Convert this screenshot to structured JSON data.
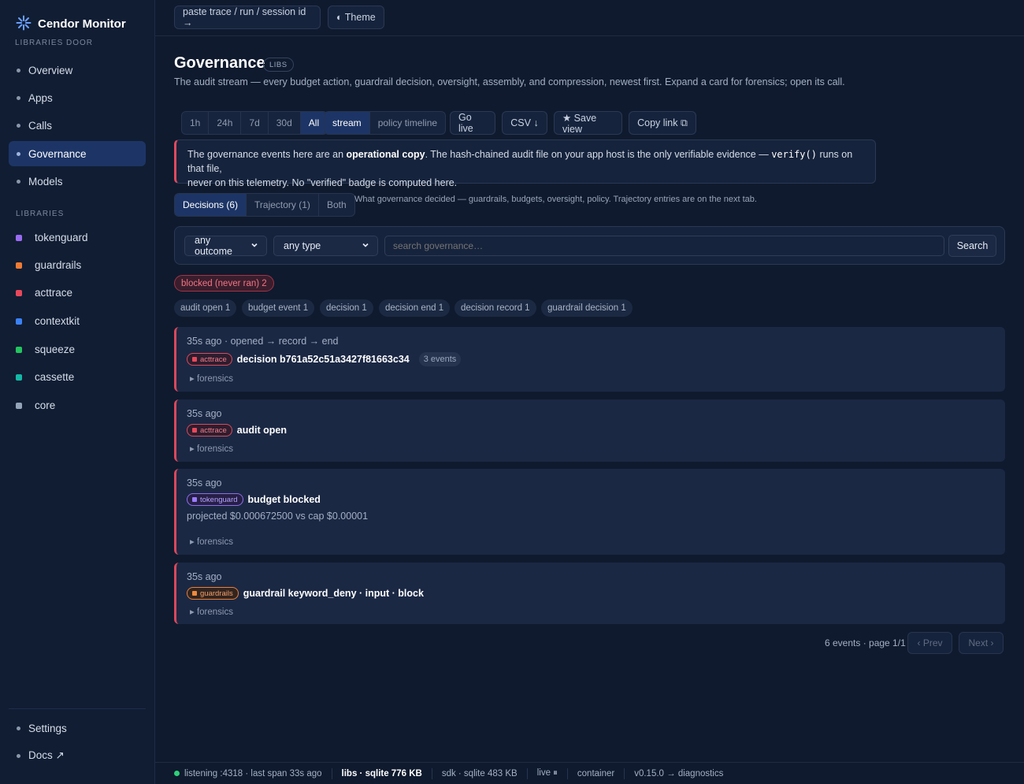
{
  "app": {
    "name": "Cendor Monitor",
    "subtitle": "LIBRARIES DOOR"
  },
  "sidebar": {
    "nav": [
      {
        "label": "Overview"
      },
      {
        "label": "Apps"
      },
      {
        "label": "Calls"
      },
      {
        "label": "Governance",
        "active": true
      },
      {
        "label": "Models"
      }
    ],
    "libraries_label": "LIBRARIES",
    "libraries": [
      {
        "label": "tokenguard",
        "color": "#9a6bf2"
      },
      {
        "label": "guardrails",
        "color": "#f07b32"
      },
      {
        "label": "acttrace",
        "color": "#e8485b"
      },
      {
        "label": "contextkit",
        "color": "#3b82f6"
      },
      {
        "label": "squeeze",
        "color": "#22c55e"
      },
      {
        "label": "cassette",
        "color": "#14b8a6"
      },
      {
        "label": "core",
        "color": "#94a3b8"
      }
    ],
    "footer": [
      {
        "label": "Settings"
      },
      {
        "label": "Docs ↗"
      }
    ]
  },
  "topbar": {
    "trace_input": "paste trace / run / session id →",
    "theme": "◐ Theme"
  },
  "page": {
    "title": "Governance",
    "badge": "LIBS",
    "subtitle": "The audit stream — every budget action, guardrail decision, oversight, assembly, and compression, newest first. Expand a card for forensics; open its call."
  },
  "toolbar": {
    "ranges": [
      "1h",
      "24h",
      "7d",
      "30d",
      "All"
    ],
    "active_range": "All",
    "views": [
      "stream",
      "policy timeline"
    ],
    "active_view": "stream",
    "go_live": "Go live",
    "csv": "CSV ↓",
    "save_view": "★ Save view",
    "copy_link": "Copy link ⧉"
  },
  "warning": {
    "part1": "The governance events here are an ",
    "bold": "operational copy",
    "part2": ". The hash-chained audit file on your app host is the only verifiable evidence — ",
    "code": "verify()",
    "part3": " runs on that file,",
    "line2": "never on this telemetry. No \"verified\" badge is computed here."
  },
  "tabs": {
    "items": [
      "Decisions (6)",
      "Trajectory (1)",
      "Both"
    ],
    "active": "Decisions (6)",
    "hint": "What governance decided — guardrails, budgets, oversight, policy. Trajectory entries are on the next tab."
  },
  "filters": {
    "outcome": "any outcome",
    "type": "any type",
    "search_placeholder": "search governance…",
    "search_button": "Search"
  },
  "chips": {
    "blocked": "blocked (never ran) 2",
    "types": [
      "audit open 1",
      "budget event 1",
      "decision 1",
      "decision end 1",
      "decision record 1",
      "guardrail decision 1"
    ]
  },
  "events": [
    {
      "time": "35s ago · opened → record → end",
      "lib": "acttrace",
      "title": "decision b761a52c51a3427f81663c34",
      "count": "3 events",
      "forensics": "▸ forensics"
    },
    {
      "time": "35s ago",
      "lib": "acttrace",
      "title": "audit open",
      "forensics": "▸ forensics"
    },
    {
      "time": "35s ago",
      "lib": "tokenguard",
      "title": "budget blocked",
      "detail": "projected $0.000672500 vs cap $0.00001",
      "forensics": "▸ forensics"
    },
    {
      "time": "35s ago",
      "lib": "guardrails",
      "title": "guardrail keyword_deny · input · block",
      "forensics": "▸ forensics"
    }
  ],
  "pager": {
    "info": "6 events · page 1/1",
    "prev": "‹ Prev",
    "next": "Next ›"
  },
  "status": {
    "listening": "listening :4318 · last span 33s ago",
    "libs": "libs · sqlite 776 KB",
    "sdk": "sdk · sqlite 483 KB",
    "live": "live ⏸",
    "container": "container",
    "version": "v0.15.0 → diagnostics"
  },
  "colors": {
    "accent": "#1d3566",
    "danger": "#e04a5e",
    "live": "#2fd07a"
  }
}
